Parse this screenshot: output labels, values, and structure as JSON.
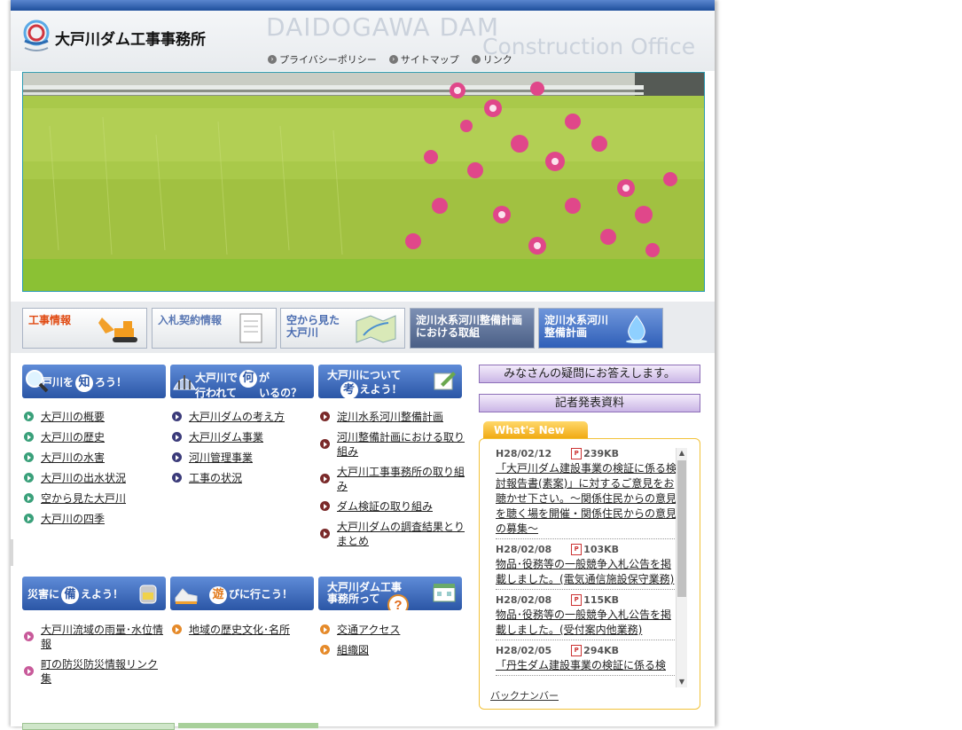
{
  "header": {
    "site_title": "大戸川ダム工事事務所",
    "en_line1": "DAIDOGAWA DAM",
    "en_line2": "Construction Office",
    "util_links": [
      "プライバシーポリシー",
      "サイトマップ",
      "リンク"
    ]
  },
  "categories": [
    {
      "label": "工事情報",
      "color": "#ffffff"
    },
    {
      "label": "入札契約情報",
      "color": "#ffffff"
    },
    {
      "label": "空から見た\n大戸川",
      "color": "#ffffff"
    },
    {
      "label": "淀川水系河川整備計画\nにおける取組",
      "color": "#5a6f95"
    },
    {
      "label": "淀川水系河川\n整備計画",
      "color": "#4f79c6"
    }
  ],
  "columns": {
    "know": {
      "button": [
        "大戸川を",
        "知",
        "ろう！"
      ],
      "links": [
        "大戸川の概要",
        "大戸川の歴史",
        "大戸川の水害",
        "大戸川の出水状況",
        "空から見た大戸川",
        "大戸川の四季"
      ]
    },
    "what": {
      "button": [
        "大戸川で",
        "何",
        "が",
        "行われて",
        "いるの？"
      ],
      "links": [
        "大戸川ダムの考え方",
        "大戸川ダム事業",
        "河川管理事業",
        "工事の状況"
      ]
    },
    "think": {
      "button": [
        "大戸川について",
        "考",
        "えよう！"
      ],
      "links": [
        "淀川水系河川整備計画",
        "河川整備計画における取り組み",
        "大戸川工事事務所の取り組み",
        "ダム検証の取り組み",
        "大戸川ダムの調査結果とりまとめ"
      ]
    },
    "prepare": {
      "button": [
        "災害に",
        "備",
        "えよう！"
      ],
      "links": [
        "大戸川流域の雨量･水位情報",
        "町の防災防災情報リンク集"
      ]
    },
    "play": {
      "button": [
        "",
        "遊",
        "びに行こう！"
      ],
      "links": [
        "地域の歴史文化･名所"
      ]
    },
    "office": {
      "button": [
        "大戸川ダム工事",
        "事務所って"
      ],
      "links": [
        "交通アクセス",
        "組織図"
      ]
    }
  },
  "side": {
    "faq_label": "みなさんの疑問にお答えします。",
    "press_label": "記者発表資料",
    "news_tab": "What's New",
    "news": [
      {
        "date": "H28/02/12",
        "size": "239KB",
        "text": "「大戸川ダム建設事業の検証に係る検討報告書(素案)」に対するご意見をお聴かせ下さい。～関係住民からの意見を聴く場を開催・関係住民からの意見の募集～"
      },
      {
        "date": "H28/02/08",
        "size": "103KB",
        "text": "物品･役務等の一般競争入札公告を掲載しました。(電気通信施設保守業務)"
      },
      {
        "date": "H28/02/08",
        "size": "115KB",
        "text": "物品･役務等の一般競争入札公告を掲載しました。(受付案内他業務)"
      },
      {
        "date": "H28/02/05",
        "size": "294KB",
        "text": "「丹生ダム建設事業の検証に係る検"
      }
    ],
    "back_number": "バックナンバー"
  }
}
